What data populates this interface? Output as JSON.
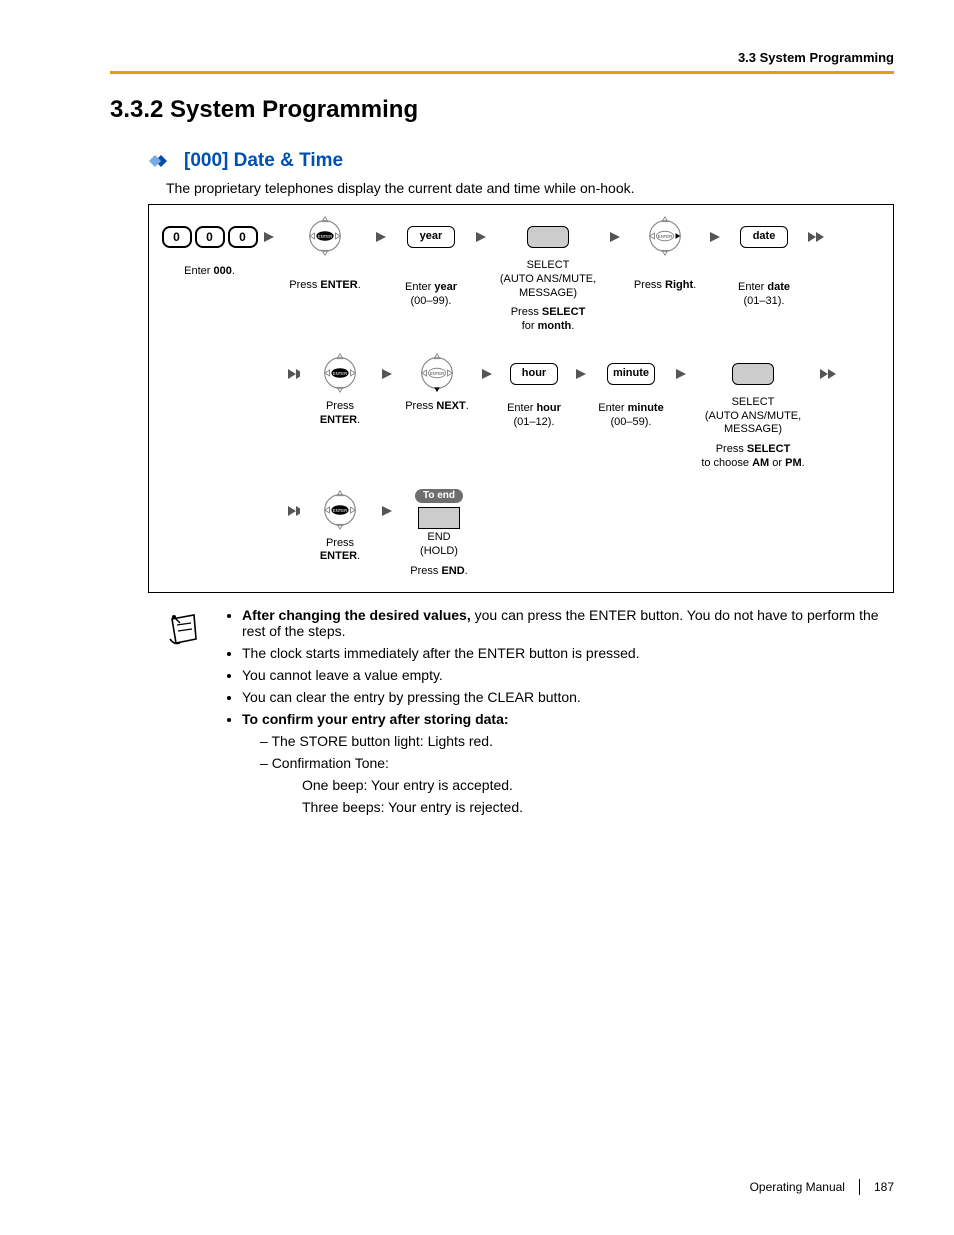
{
  "header": {
    "running": "3.3 System Programming"
  },
  "title": "3.3.2   System Programming",
  "subsection": "[000] Date & Time",
  "intro": "The proprietary telephones display the current date and time while on-hook.",
  "flow": {
    "enter000_key": "0",
    "enter000_cap_pre": "Enter ",
    "enter000_cap_bold": "000",
    "enter000_cap_post": ".",
    "press_enter_pre": "Press ",
    "press_enter_bold": "ENTER",
    "press_enter_post": ".",
    "year_label": "year",
    "year_cap_pre": "Enter ",
    "year_cap_bold": "year",
    "year_cap_post": " (00–99).",
    "select_top": "SELECT",
    "select_sub": "(AUTO ANS/MUTE, MESSAGE)",
    "press_select_pre": "Press ",
    "press_select_bold": "SELECT",
    "press_select_post": " for ",
    "press_select_bold2": "month",
    "press_select_post2": ".",
    "press_right_pre": "Press ",
    "press_right_bold": "Right",
    "press_right_post": ".",
    "date_label": "date",
    "date_cap_pre": "Enter ",
    "date_cap_bold": "date",
    "date_cap_post": " (01–31).",
    "press_next_pre": "Press ",
    "press_next_bold": "NEXT",
    "press_next_post": ".",
    "hour_label": "hour",
    "hour_cap_pre": "Enter ",
    "hour_cap_bold": "hour",
    "hour_cap_post": " (01–12).",
    "minute_label": "minute",
    "minute_cap_pre": "Enter ",
    "minute_cap_bold": "minute",
    "minute_cap_post": " (00–59).",
    "ampm_pre": "Press ",
    "ampm_bold": "SELECT",
    "ampm_mid": " to choose ",
    "ampm_am": "AM",
    "ampm_or": " or ",
    "ampm_pm": "PM",
    "ampm_post": ".",
    "to_end": "To end",
    "end_top": "END",
    "end_sub": "(HOLD)",
    "press_end_pre": "Press ",
    "press_end_bold": "END",
    "press_end_post": "."
  },
  "notes": {
    "n1_bold": "After changing the desired values,",
    "n1_rest": " you can press the ENTER button. You do not have to perform the rest of the steps.",
    "n2": "The clock starts immediately after the ENTER button is pressed.",
    "n3": "You cannot leave a value empty.",
    "n4": "You can clear the entry by pressing the CLEAR button.",
    "n5_bold": "To confirm your entry after storing data:",
    "n5a": "The STORE button light: Lights red.",
    "n5b": "Confirmation Tone:",
    "n5b1": "One beep: Your entry is accepted.",
    "n5b2": "Three beeps: Your entry is rejected."
  },
  "footer": {
    "manual": "Operating Manual",
    "page": "187"
  }
}
